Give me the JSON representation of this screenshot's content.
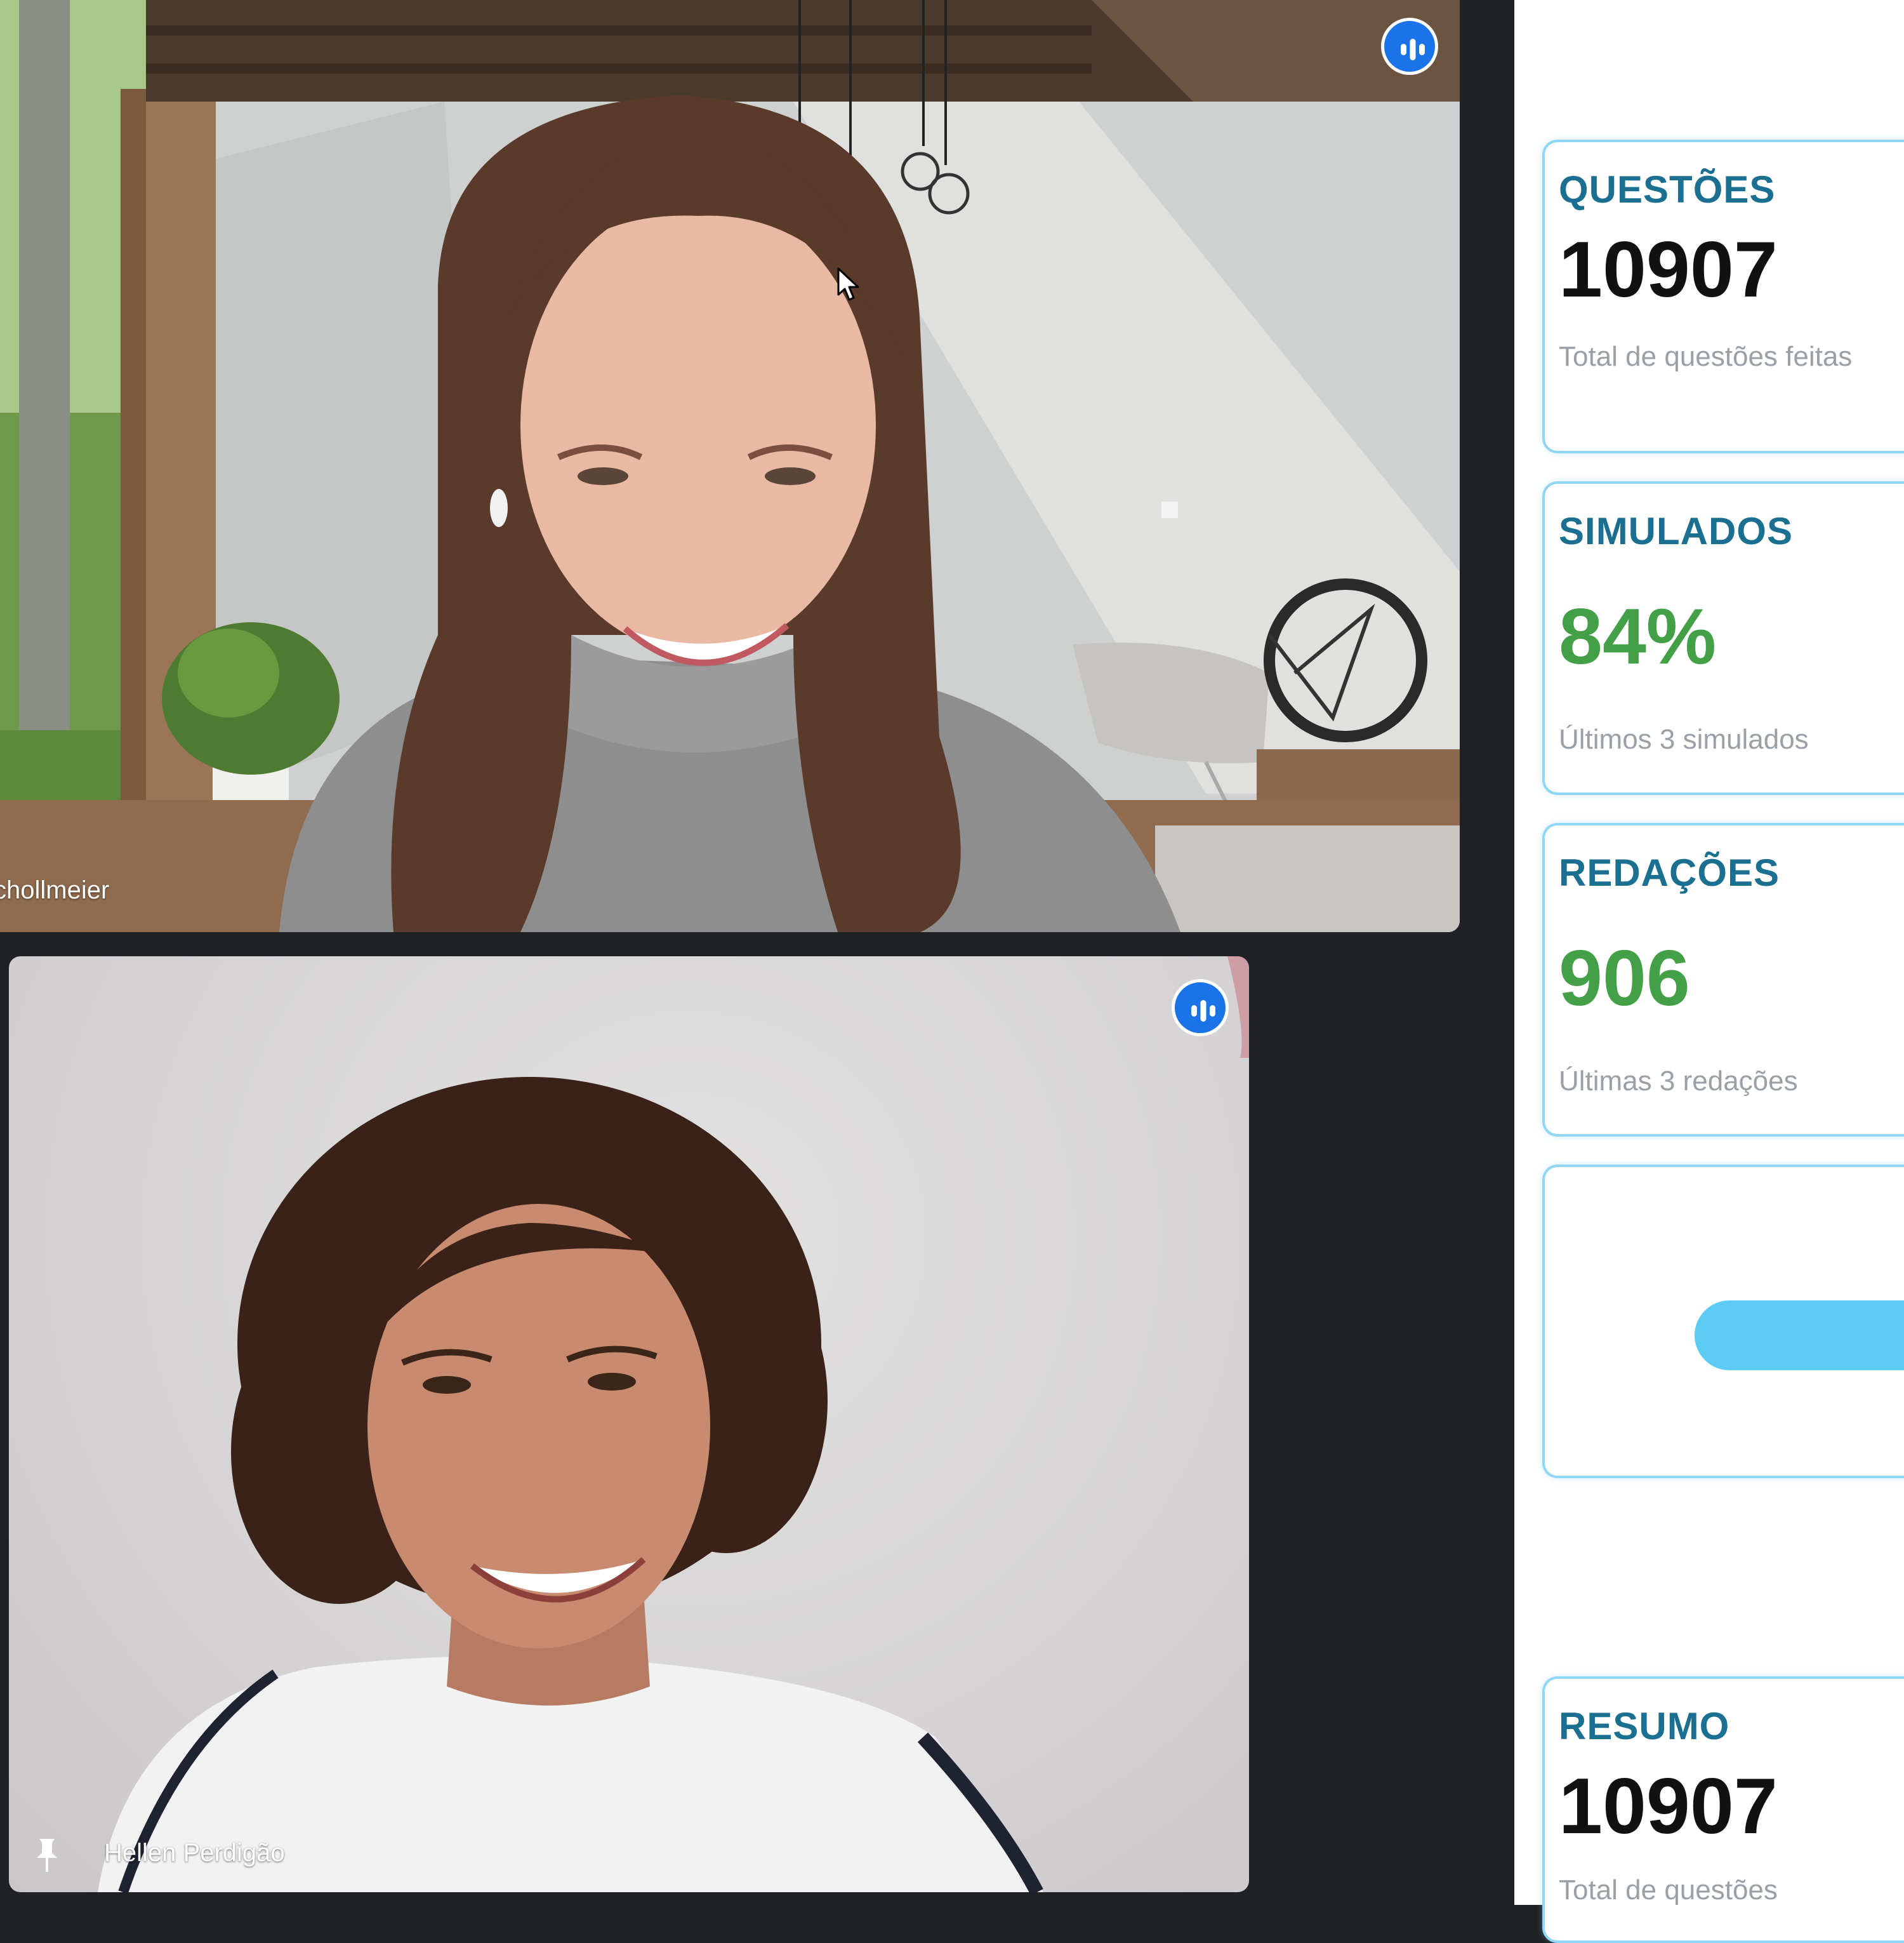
{
  "participants": [
    {
      "name": "chollmeier",
      "speaking": true
    },
    {
      "name": "Hellen Perdigão",
      "speaking": true,
      "pinned": true
    }
  ],
  "dashboard": {
    "cards": [
      {
        "title": "QUESTÕES",
        "value": "10907",
        "value_color": "#111111",
        "subtitle": "Total de questões feitas"
      },
      {
        "title": "SIMULADOS",
        "value": "84%",
        "value_color": "#43a047",
        "subtitle": "Últimos 3 simulados"
      },
      {
        "title": "REDAÇÕES",
        "value": "906",
        "value_color": "#43a047",
        "subtitle": "Últimas 3 redações"
      },
      {
        "title": "RESUMO",
        "value": "10907",
        "value_color": "#111111",
        "subtitle": "Total de questões"
      }
    ]
  },
  "colors": {
    "accent_blue": "#1a73e8",
    "card_title": "#1b6f91",
    "card_border": "#8fd6f7",
    "button_blue": "#5ccbf5",
    "stat_green": "#43a047",
    "call_background": "#202124"
  },
  "icons": [
    "speaking-indicator-icon",
    "pin-icon",
    "mouse-cursor-icon"
  ]
}
